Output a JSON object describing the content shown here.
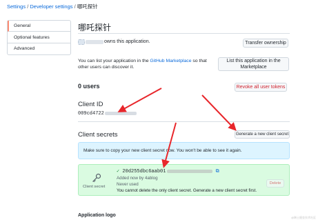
{
  "breadcrumb": {
    "items": [
      "Settings",
      "Developer settings",
      "哪吒探针"
    ],
    "separator": "/"
  },
  "sidebar": {
    "items": [
      {
        "label": "General",
        "active": true
      },
      {
        "label": "Optional features",
        "active": false
      },
      {
        "label": "Advanced",
        "active": false
      }
    ]
  },
  "app": {
    "name": "哪吒探针",
    "owner_text": "owns this application.",
    "transfer_label": "Transfer ownership",
    "marketplace_text_1": "You can list your application in the",
    "marketplace_link": "GitHub Marketplace",
    "marketplace_text_2": "so that other users can discover it.",
    "list_button": "List this application in the Marketplace",
    "users_count": "0 users",
    "revoke_label": "Revoke all user tokens",
    "client_id_heading": "Client ID",
    "client_id_value": "009cd4722",
    "client_secrets_heading": "Client secrets",
    "generate_label": "Generate a new client secret",
    "notice_text": "Make sure to copy your new client secret now. You won't be able to see it again.",
    "secret": {
      "value": "20d255dbc6aab01",
      "added_by": "Added now by 4ablog",
      "usage": "Never used",
      "warning": "You cannot delete the only client secret. Generate a new client secret first.",
      "delete_label": "Delete",
      "icon_label": "Client secret"
    },
    "logo_heading": "Application logo"
  },
  "watermark": "@稀土掘金技术社区",
  "colors": {
    "accent": "#0969da",
    "danger": "#cf222e",
    "arrow": "#e8262b",
    "success_bg": "#dafbe1",
    "info_bg": "#ddf4ff"
  }
}
